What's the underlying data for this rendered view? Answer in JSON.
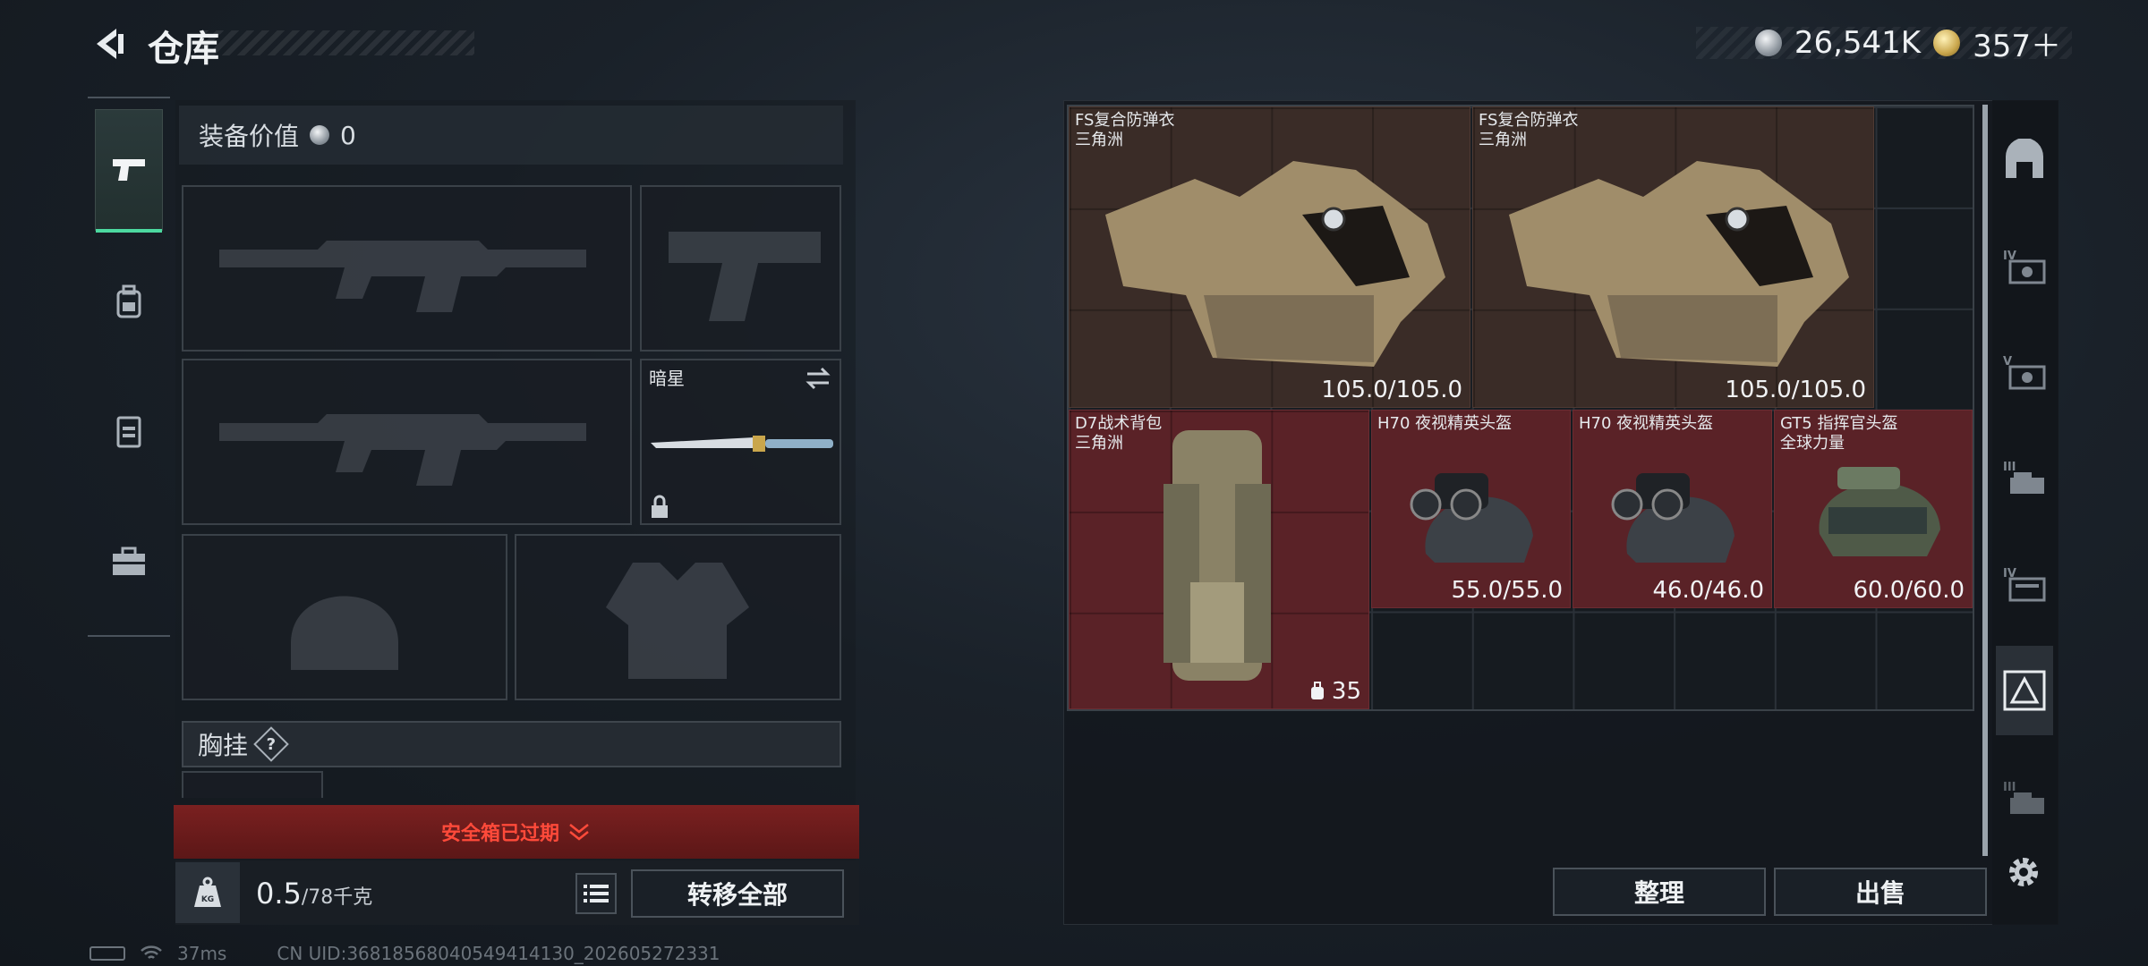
{
  "header": {
    "title": "仓库",
    "currencies": [
      {
        "icon": "silver-coin-icon",
        "value": "26,541K"
      },
      {
        "icon": "gold-coin-icon",
        "value": "357＋"
      }
    ]
  },
  "left_tabs": [
    {
      "icon": "pistol-icon",
      "active": true
    },
    {
      "icon": "backpack-icon",
      "active": false
    },
    {
      "icon": "vest-icon",
      "active": false
    },
    {
      "icon": "briefcase-icon",
      "active": false
    }
  ],
  "loadout": {
    "value_label": "装备价值",
    "value": "0",
    "knife_name": "暗星",
    "chest_label": "胸挂",
    "help_label": "?"
  },
  "safe_box": {
    "expired_text": "安全箱已过期"
  },
  "bottom_bar": {
    "weight_current": "0.5",
    "weight_max": "/78千克",
    "kg_icon": "KG",
    "transfer_label": "转移全部"
  },
  "stash_items": [
    {
      "name": "FS复合防弹衣\n三角洲",
      "durability": "105.0/105.0",
      "rarity": "brown"
    },
    {
      "name": "FS复合防弹衣\n三角洲",
      "durability": "105.0/105.0",
      "rarity": "brown"
    },
    {
      "name": "D7战术背包\n三角洲",
      "capacity": "35",
      "rarity": "red"
    },
    {
      "name": "H70 夜视精英头盔",
      "durability": "55.0/55.0",
      "rarity": "red"
    },
    {
      "name": "H70 夜视精英头盔",
      "durability": "46.0/46.0",
      "rarity": "red"
    },
    {
      "name": "GT5 指挥官头盔\n全球力量",
      "durability": "60.0/60.0",
      "rarity": "red"
    }
  ],
  "actions": {
    "sort_label": "整理",
    "sell_label": "出售"
  },
  "status": {
    "ping": "37ms",
    "uid": "CN UID:36818568040549414130_202605272331"
  },
  "right_sidebar": [
    {
      "icon": "stash-home-icon",
      "label": ""
    },
    {
      "icon": "container-iv-icon",
      "label": "IV"
    },
    {
      "icon": "container-v-icon",
      "label": "V"
    },
    {
      "icon": "container-iii-icon",
      "label": "III"
    },
    {
      "icon": "container-iv-2-icon",
      "label": "IV"
    },
    {
      "icon": "delta-stash-icon",
      "label": ""
    },
    {
      "icon": "container-iii-2-icon",
      "label": "III"
    }
  ]
}
